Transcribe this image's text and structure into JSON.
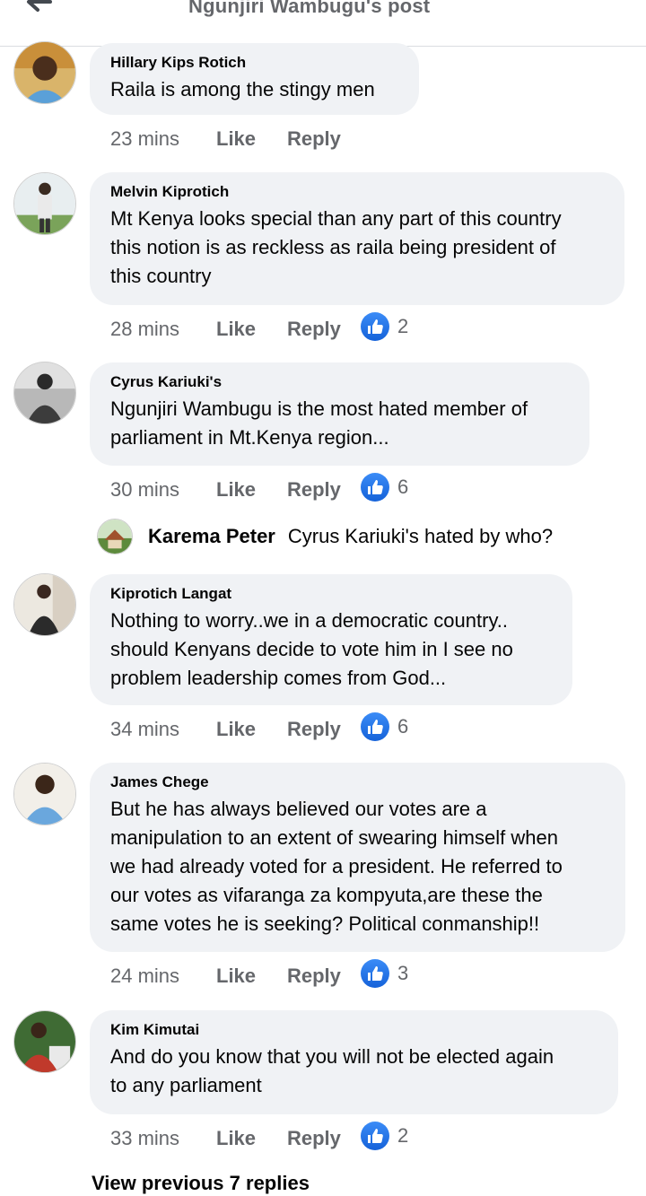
{
  "header": {
    "title": "Ngunjiri Wambugu's post"
  },
  "actions": {
    "like_label": "Like",
    "reply_label": "Reply"
  },
  "comments": [
    {
      "author": "Hillary Kips Rotich",
      "lines": [
        "Raila is among the stingy men"
      ],
      "time": "23 mins",
      "likes": ""
    },
    {
      "author": "Melvin Kiprotich",
      "lines": [
        "Mt Kenya looks special than any part of this country",
        "this notion is as reckless as raila being president of",
        "this country"
      ],
      "time": "28 mins",
      "likes": "2"
    },
    {
      "author": "Cyrus Kariuki's",
      "lines": [
        "Ngunjiri Wambugu is the most hated member of",
        "parliament in Mt.Kenya region..."
      ],
      "time": "30 mins",
      "likes": "6"
    },
    {
      "author": "Kiprotich Langat",
      "lines": [
        "Nothing to worry..we in a democratic country..",
        "should Kenyans decide to vote him in I see no",
        "problem leadership comes from God..."
      ],
      "time": "34 mins",
      "likes": "6"
    },
    {
      "author": "James Chege",
      "lines": [
        "But he has always believed our votes are a",
        "manipulation to an extent of swearing himself when",
        "we had already voted for a president. He referred to",
        "our votes as vifaranga za kompyuta,are these the",
        "same votes he is seeking? Political conmanship!!"
      ],
      "time": "24 mins",
      "likes": "3"
    },
    {
      "author": "Kim Kimutai",
      "lines": [
        "And do you know that you will not be elected again",
        "to any parliament"
      ],
      "time": "33 mins",
      "likes": "2"
    }
  ],
  "reply_preview": {
    "author": "Karema Peter",
    "text": "Cyrus Kariuki's hated by who?"
  },
  "view_previous": "View previous 7 replies",
  "colors": {
    "like_blue": "#1877f2",
    "bubble_bg": "#f0f2f5",
    "meta_gray": "#65676b"
  }
}
